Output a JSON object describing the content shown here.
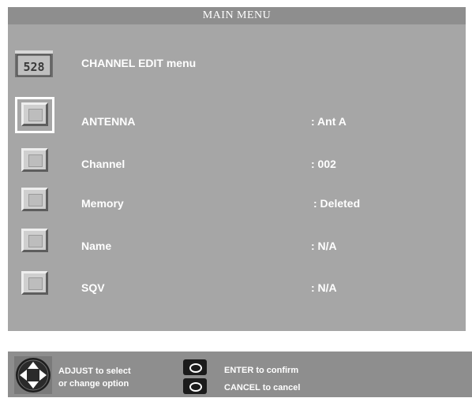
{
  "window": {
    "title": "MAIN MENU"
  },
  "header": {
    "icon_text": "528",
    "title": "CHANNEL EDIT menu"
  },
  "rows": [
    {
      "label": "ANTENNA",
      "value": ": Ant A",
      "selected": true
    },
    {
      "label": "Channel",
      "value": ": 002",
      "selected": false
    },
    {
      "label": "Memory",
      "value": ": Deleted",
      "selected": false
    },
    {
      "label": "Name",
      "value": ": N/A",
      "selected": false
    },
    {
      "label": "SQV",
      "value": ": N/A",
      "selected": false
    }
  ],
  "footer": {
    "adjust_line1": "ADJUST to select",
    "adjust_line2": "or change option",
    "enter_text": "ENTER to confirm",
    "cancel_text": "CANCEL to cancel"
  }
}
